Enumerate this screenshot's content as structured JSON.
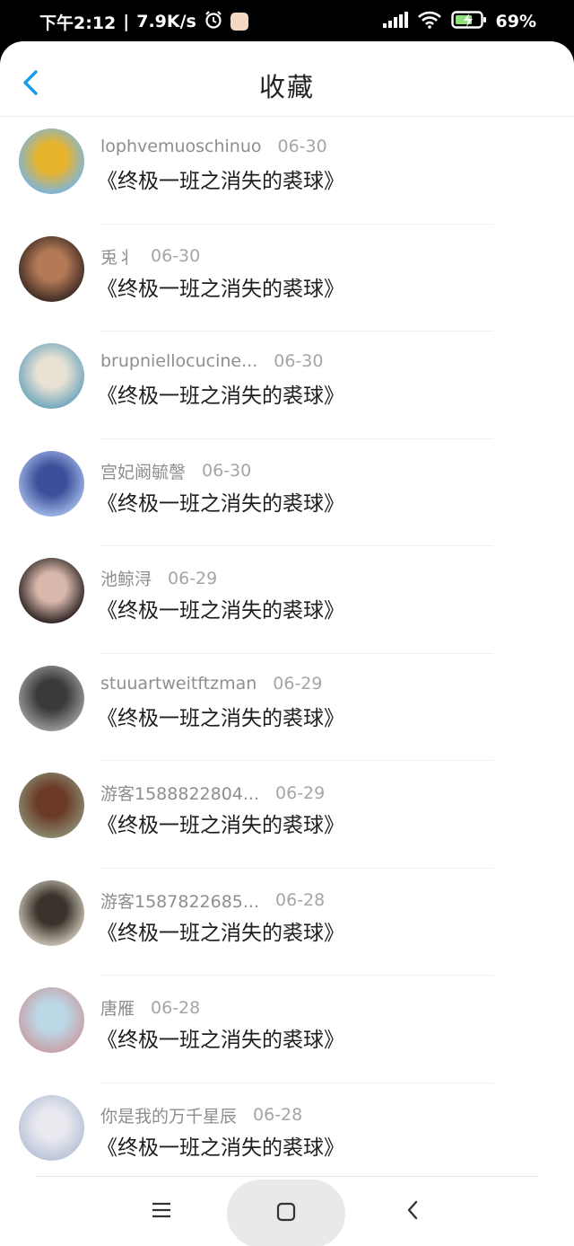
{
  "status": {
    "time": "下午2:12",
    "speed": "7.9K/s",
    "battery": "69%"
  },
  "header": {
    "title": "收藏",
    "back_icon": "chevron-left-icon"
  },
  "favorites": [
    {
      "user": "lophvemuoschinuo",
      "date": "06-30",
      "book": "《终极一班之消失的裘球》",
      "avatar_colors": [
        "#7bb5e0",
        "#e8b42b"
      ]
    },
    {
      "user": "兎丬",
      "date": "06-30",
      "book": "《终极一班之消失的裘球》",
      "avatar_colors": [
        "#3b2a22",
        "#b47a57"
      ]
    },
    {
      "user": "brupniellocucine...",
      "date": "06-30",
      "book": "《终极一班之消失的裘球》",
      "avatar_colors": [
        "#6ea6bd",
        "#e9e2d4"
      ]
    },
    {
      "user": "宫妃阚毓謦",
      "date": "06-30",
      "book": "《终极一班之消失的裘球》",
      "avatar_colors": [
        "#9fb6e6",
        "#3d4f9a"
      ]
    },
    {
      "user": "池鲸浔",
      "date": "06-29",
      "book": "《终极一班之消失的裘球》",
      "avatar_colors": [
        "#2a2020",
        "#d9b8ac"
      ]
    },
    {
      "user": "stuuartweitftzman",
      "date": "06-29",
      "book": "《终极一班之消失的裘球》",
      "avatar_colors": [
        "#9a9a9a",
        "#3a3a3a"
      ]
    },
    {
      "user": "游客1588822804...",
      "date": "06-29",
      "book": "《终极一班之消失的裘球》",
      "avatar_colors": [
        "#8b8a70",
        "#6b3b28"
      ]
    },
    {
      "user": "游客1587822685...",
      "date": "06-28",
      "book": "《终极一班之消失的裘球》",
      "avatar_colors": [
        "#c9c2b4",
        "#3a332b"
      ]
    },
    {
      "user": "唐雁",
      "date": "06-28",
      "book": "《终极一班之消失的裘球》",
      "avatar_colors": [
        "#c7a0a6",
        "#bcd7e6"
      ]
    },
    {
      "user": "你是我的万千星辰",
      "date": "06-28",
      "book": "《终极一班之消失的裘球》",
      "avatar_colors": [
        "#b8c4d8",
        "#e9e9ef"
      ]
    }
  ],
  "navbar": {
    "menu_icon": "menu-icon",
    "home_icon": "square-home-icon",
    "back_icon": "back-triangle-icon"
  }
}
